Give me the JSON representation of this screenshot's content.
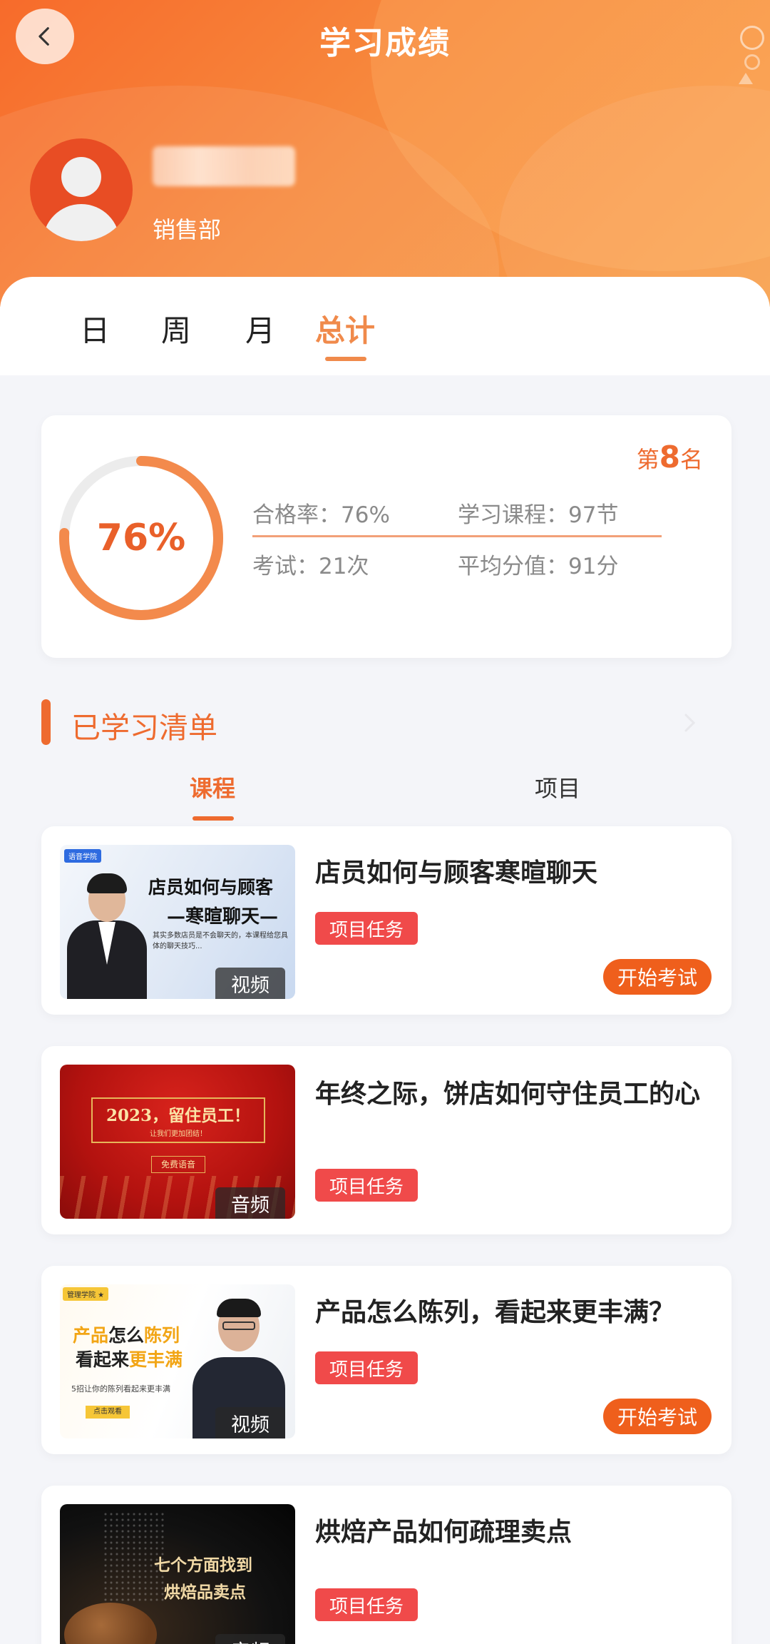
{
  "header": {
    "title": "学习成绩",
    "back_icon": "chevron-left-icon",
    "user": {
      "name_blurred": true,
      "department": "销售部"
    }
  },
  "period_tabs": [
    {
      "label": "日",
      "active": false
    },
    {
      "label": "周",
      "active": false
    },
    {
      "label": "月",
      "active": false
    },
    {
      "label": "总计",
      "active": true
    }
  ],
  "stats": {
    "percent_label": "76%",
    "percent_value": 0.76,
    "rank_prefix": "第",
    "rank_number": "8",
    "rank_suffix": "名",
    "pass_rate": "合格率：76%",
    "courses": "学习课程：97节",
    "exams": "考试：21次",
    "avg_score": "平均分值：91分"
  },
  "learned": {
    "title": "已学习清单",
    "tabs": [
      {
        "label": "课程",
        "active": true
      },
      {
        "label": "项目",
        "active": false
      }
    ]
  },
  "courses": [
    {
      "title": "店员如何与顾客寒暄聊天",
      "tag": "项目任务",
      "media_type": "视频",
      "action": "开始考试",
      "thumb_text": [
        "店员如何与顾客",
        "—寒暄聊天—",
        "其实多数店员是不会聊天的，本课程给您具体的聊天技巧..."
      ],
      "thumb_badge": "语音学院"
    },
    {
      "title": "年终之际，饼店如何守住员工的心",
      "tag": "项目任务",
      "media_type": "音频",
      "action": "",
      "thumb_text": [
        "2023，留住员工！",
        "让我们更加团结！",
        "免费语音"
      ]
    },
    {
      "title": "产品怎么陈列，看起来更丰满？",
      "tag": "项目任务",
      "media_type": "视频",
      "action": "开始考试",
      "thumb_text": [
        "产品",
        "怎么",
        "陈列",
        "看起来",
        "更丰满",
        "5招让你的陈列看起来更丰满",
        "点击观看"
      ],
      "thumb_badge": "管理学院 ★"
    },
    {
      "title": "烘焙产品如何疏理卖点",
      "tag": "项目任务",
      "media_type": "音频",
      "action": "",
      "thumb_text": [
        "七个方面找到",
        "烘焙品卖点"
      ]
    }
  ],
  "colors": {
    "accent": "#ee6b2f",
    "tag_red": "#f04a4a",
    "header_start": "#f76b2b",
    "header_end": "#f8a24f"
  }
}
